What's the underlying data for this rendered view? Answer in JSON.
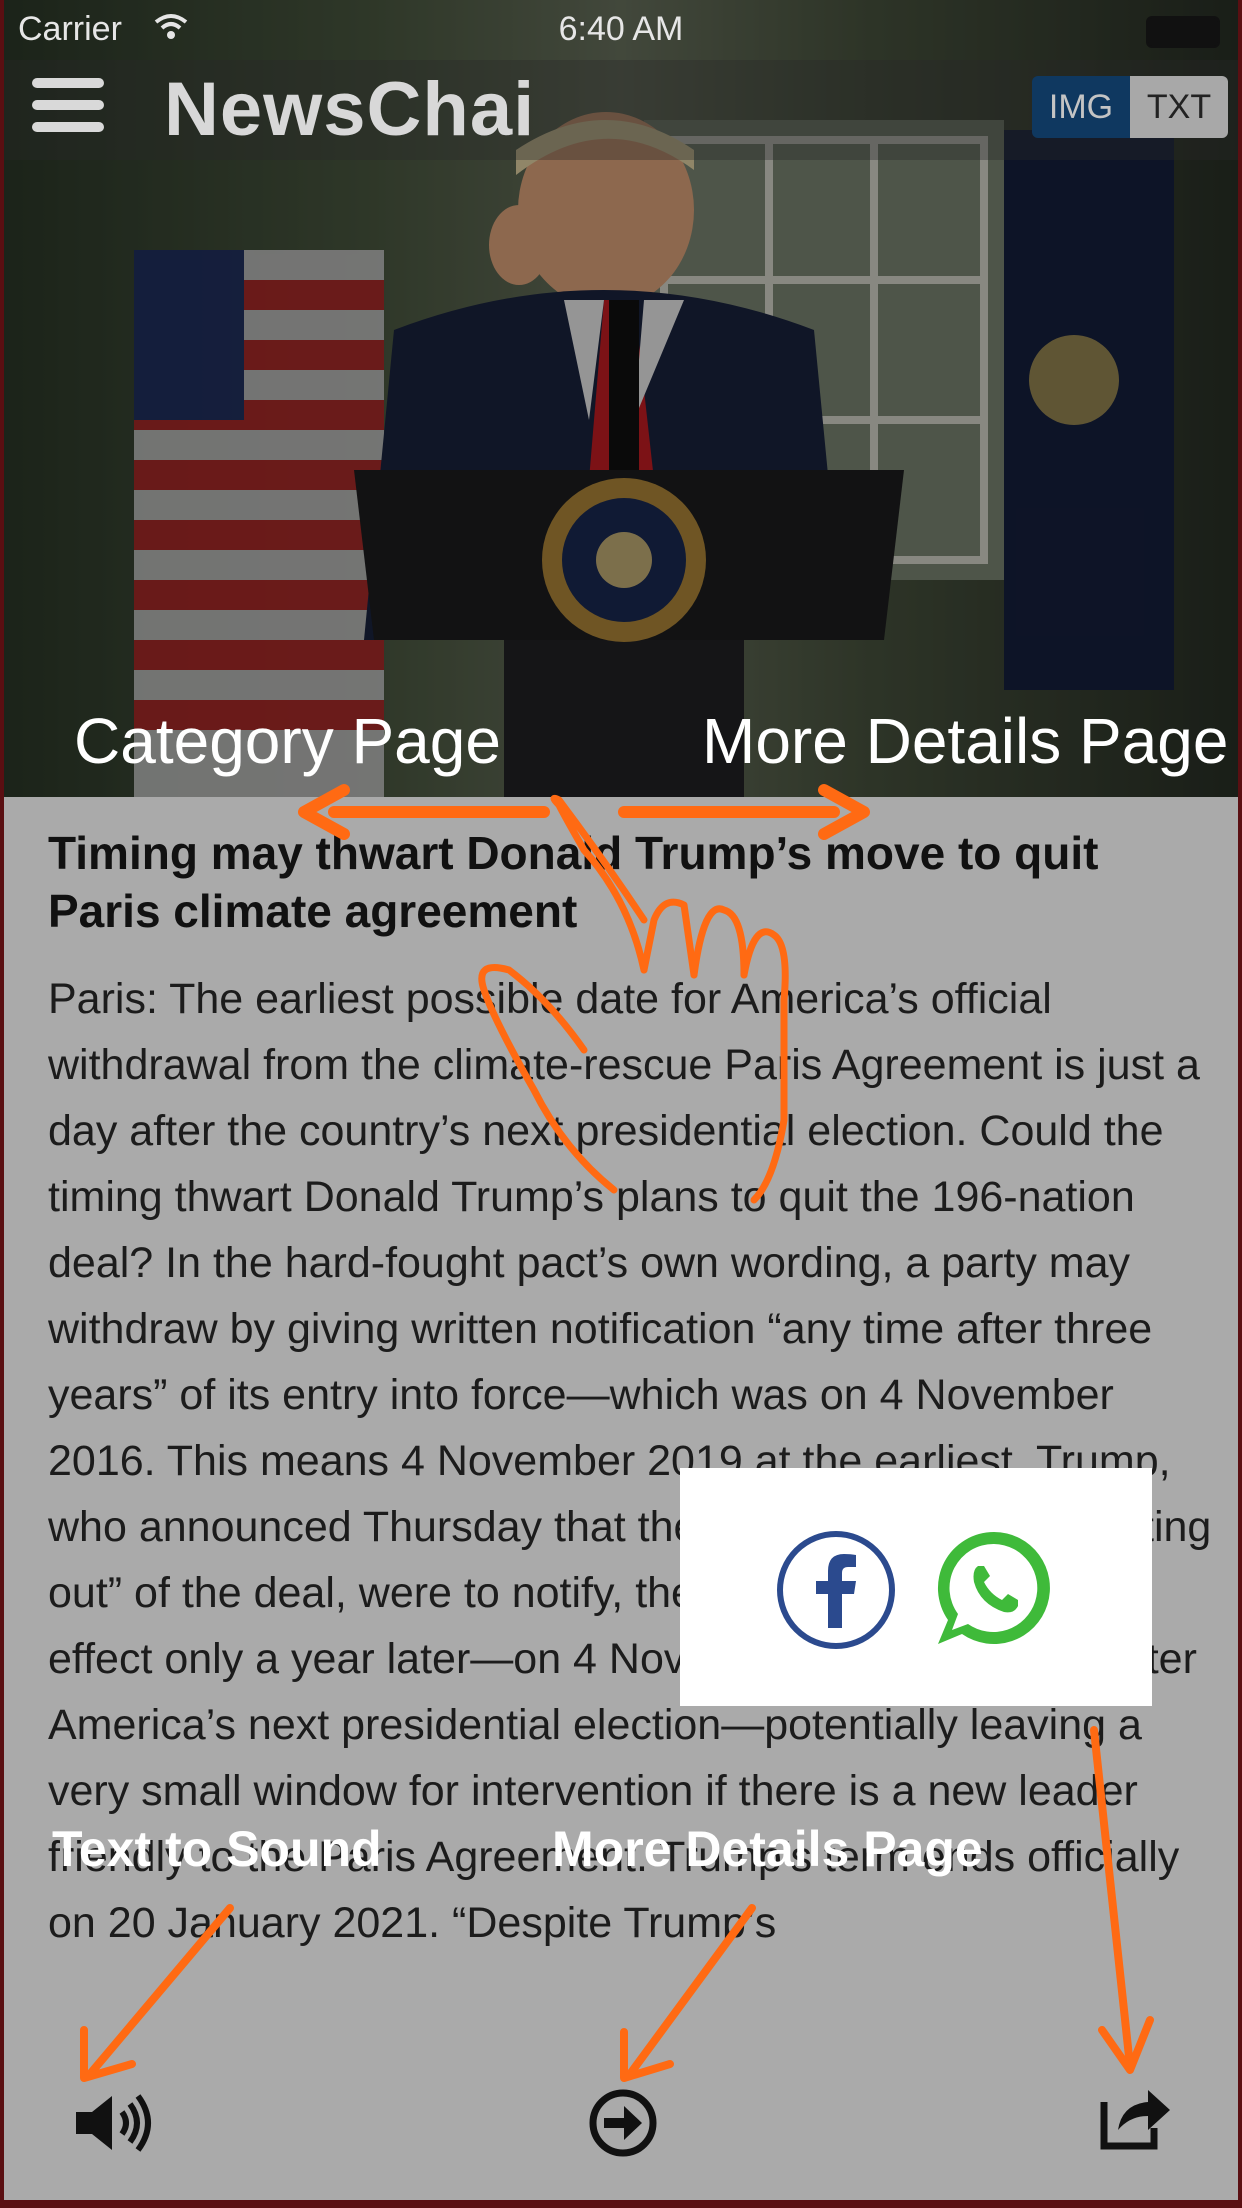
{
  "status_bar": {
    "carrier": "Carrier",
    "time": "6:40 AM"
  },
  "app": {
    "logo": "NewsChai"
  },
  "view_toggle": {
    "img_label": "IMG",
    "txt_label": "TXT",
    "selected": "IMG"
  },
  "hints": {
    "category_page": "Category Page",
    "more_details_page_top": "More Details Page",
    "text_to_sound": "Text to Sound",
    "more_details_page_bottom": "More Details Page"
  },
  "article": {
    "headline": "Timing may thwart Donald Trump’s move to quit Paris climate agreement",
    "body": "Paris: The earliest possible date for America’s official withdrawal from the climate-rescue Paris Agreement is just a day after the country’s next presidential election. Could the timing thwart Donald Trump’s plans to quit the 196-nation deal? In the hard-fought pact’s own wording, a party may withdraw by giving written notification “any time after three years” of its entry into force—which was on 4 November 2016. This means 4 November 2019 at the earliest. Trump, who announced Thursday that the United States was “getting out” of the deal, were to notify, the withdrawal would take effect only a year later—on 4 November 2020—the day after America’s next presidential election—potentially leaving a very small window for intervention if there is a new leader friendly to the Paris Agreement. Trump’s term ends officially on 20 January 2021. “Despite Trump’s"
  },
  "share": {
    "icons": [
      "facebook-icon",
      "whatsapp-icon"
    ]
  },
  "bottom_bar": {
    "icons": [
      "speaker-icon",
      "arrow-right-circle-icon",
      "share-icon"
    ]
  },
  "colors": {
    "accent_orange": "#ff6a13",
    "toggle_active": "#0f3860",
    "facebook": "#2b4a8e",
    "whatsapp": "#3fba3a"
  }
}
